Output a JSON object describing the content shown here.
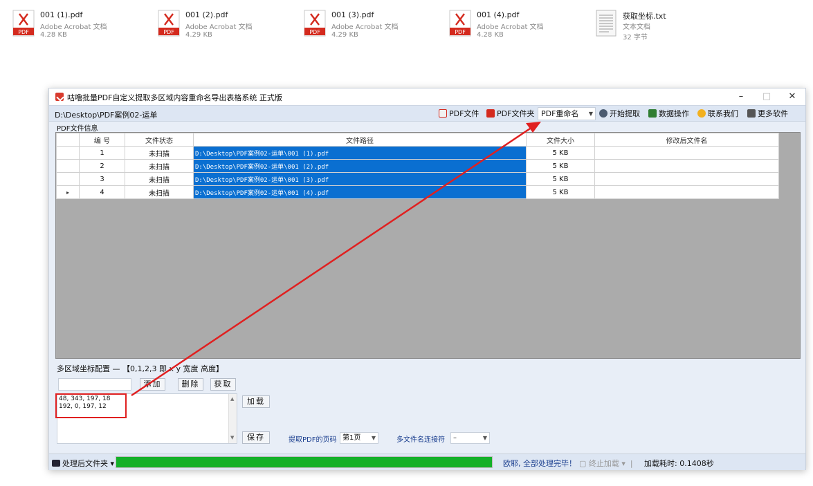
{
  "desktop_files": [
    {
      "name": "001 (1).pdf",
      "type": "Adobe Acrobat 文档",
      "size": "4.28 KB",
      "icon": "pdf-icon"
    },
    {
      "name": "001 (2).pdf",
      "type": "Adobe Acrobat 文档",
      "size": "4.29 KB",
      "icon": "pdf-icon"
    },
    {
      "name": "001 (3).pdf",
      "type": "Adobe Acrobat 文档",
      "size": "4.29 KB",
      "icon": "pdf-icon"
    },
    {
      "name": "001 (4).pdf",
      "type": "Adobe Acrobat 文档",
      "size": "4.28 KB",
      "icon": "pdf-icon"
    },
    {
      "name": "获取坐标.txt",
      "type": "文本文档",
      "size": "32 字节",
      "icon": "text-file-icon"
    }
  ],
  "window": {
    "title": "咕噜批量PDF自定义提取多区域内容重命名导出表格系统   正式版",
    "minimize": "–",
    "maximize": "□",
    "close": "✕"
  },
  "toolbar": {
    "path": "D:\\Desktop\\PDF案例02-运单",
    "pdf_file": "PDF文件",
    "pdf_folder": "PDF文件夹",
    "rename_select": "PDF重命名",
    "start_extract": "开始提取",
    "data_ops": "数据操作",
    "contact": "联系我们",
    "more_software": "更多软件"
  },
  "grid": {
    "group_label": "PDF文件信息",
    "columns": [
      "编 号",
      "文件状态",
      "文件路径",
      "文件大小",
      "修改后文件名"
    ],
    "rows": [
      {
        "no": "1",
        "status": "未扫描",
        "path": "D:\\Desktop\\PDF案例02-运单\\001 (1).pdf",
        "size": "5 KB",
        "new_name": "",
        "marker": ""
      },
      {
        "no": "2",
        "status": "未扫描",
        "path": "D:\\Desktop\\PDF案例02-运单\\001 (2).pdf",
        "size": "5 KB",
        "new_name": "",
        "marker": ""
      },
      {
        "no": "3",
        "status": "未扫描",
        "path": "D:\\Desktop\\PDF案例02-运单\\001 (3).pdf",
        "size": "5 KB",
        "new_name": "",
        "marker": ""
      },
      {
        "no": "4",
        "status": "未扫描",
        "path": "D:\\Desktop\\PDF案例02-运单\\001 (4).pdf",
        "size": "5 KB",
        "new_name": "",
        "marker": "▸"
      }
    ]
  },
  "coords": {
    "label": "多区域坐标配置 — 【0,1,2,3 即 x y 宽度 高度】",
    "input_value": "",
    "add": "添加",
    "delete": "删除",
    "fetch": "获取",
    "load": "加载",
    "save": "保存",
    "lines": [
      "48, 343, 197, 18",
      "192, 0, 197, 12"
    ],
    "page_label": "提取PDF的页码",
    "page_value": "第1页",
    "joiner_label": "多文件名连接符",
    "joiner_value": "–"
  },
  "status": {
    "folder": "处理后文件夹",
    "progress": 1.0,
    "message": "欧耶, 全部处理完毕！",
    "stop": "终止加载",
    "time": "加载耗时: 0.1408秒"
  },
  "colors": {
    "selection": "#0a6fd1",
    "progress": "#13b029",
    "annotation": "#e02020"
  }
}
